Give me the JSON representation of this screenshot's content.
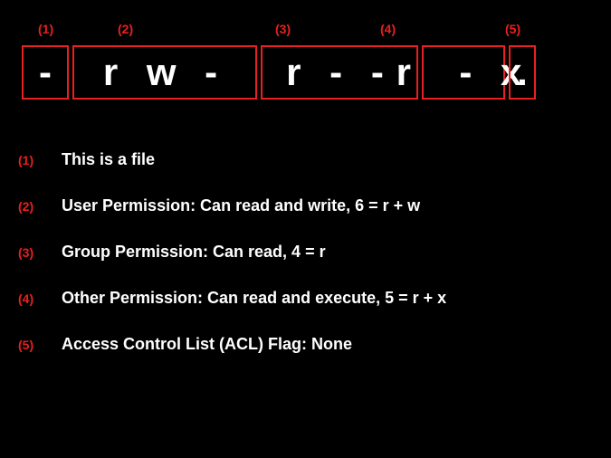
{
  "topLabels": {
    "l1": "(1)",
    "l2": "(2)",
    "l3": "(3)",
    "l4": "(4)",
    "l5": "(5)"
  },
  "boxes": {
    "b1": "-",
    "b2": "r w -",
    "b3": "r - -",
    "b4": "r  - x",
    "b5": "."
  },
  "legend": {
    "rows": [
      {
        "num": "(1)",
        "text": "This is a file"
      },
      {
        "num": "(2)",
        "text": "User Permission: Can read and write, 6 = r + w"
      },
      {
        "num": "(3)",
        "text": "Group Permission: Can read, 4 = r"
      },
      {
        "num": "(4)",
        "text": "Other Permission: Can read and execute, 5 = r + x"
      },
      {
        "num": "(5)",
        "text": "Access Control List (ACL) Flag: None"
      }
    ]
  }
}
